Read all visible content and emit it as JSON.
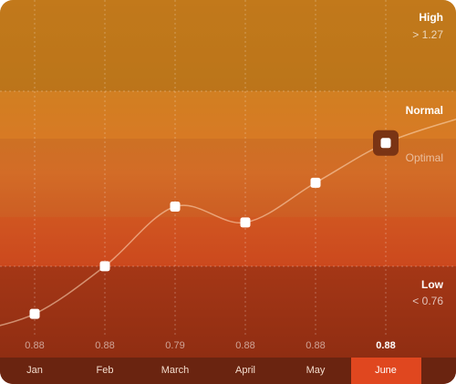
{
  "chart_data": {
    "type": "line",
    "categories": [
      "Jan",
      "Feb",
      "March",
      "April",
      "May",
      "June"
    ],
    "value_labels": [
      "0.88",
      "0.88",
      "0.79",
      "0.88",
      "0.88",
      "0.88"
    ],
    "values": [
      0.71,
      0.83,
      0.98,
      0.94,
      1.04,
      1.14
    ],
    "ylim": [
      0.6,
      1.5
    ],
    "selected": "June",
    "zones": [
      {
        "name": "High",
        "note": "> 1.27",
        "color": "#c07d1c"
      },
      {
        "name": "Normal",
        "note": "",
        "color": "#e07d27"
      },
      {
        "name": "Optimal",
        "note": "",
        "color": "#e06a2a"
      },
      {
        "name": "Low",
        "note": "< 0.76",
        "color": "#8a2a12"
      }
    ]
  }
}
